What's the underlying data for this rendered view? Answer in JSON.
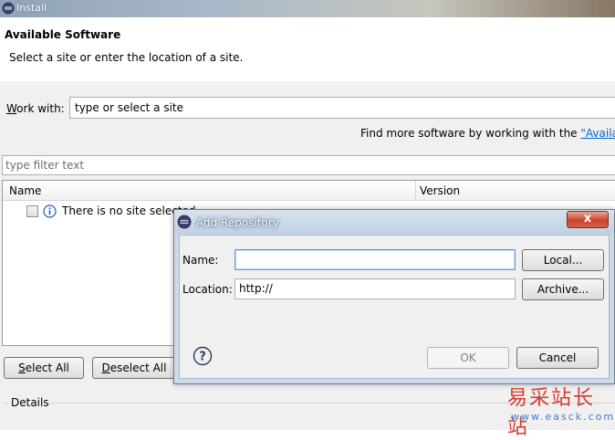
{
  "window": {
    "title": "Install"
  },
  "header": {
    "title": "Available Software",
    "description": "Select a site or enter the location of a site."
  },
  "work_with": {
    "label_prefix": "W",
    "label_rest": "ork with:",
    "value": "type or select a site"
  },
  "find_more": {
    "text": "Find more software by working with the ",
    "link": "\"Availab"
  },
  "filter": {
    "placeholder": "type filter text"
  },
  "tree": {
    "columns": [
      "Name",
      "Version"
    ],
    "rows": [
      {
        "text": "There is no site selected."
      }
    ]
  },
  "buttons": {
    "select_all": {
      "mnemonic": "S",
      "rest": "elect All"
    },
    "deselect_all": {
      "mnemonic": "D",
      "rest": "eselect All"
    }
  },
  "details": {
    "label": "Details"
  },
  "dialog": {
    "title": "Add Repository",
    "close_label": "x",
    "name_label": "Name:",
    "name_value": "",
    "location_label": "Location:",
    "location_value": "http://",
    "local_button": "Local...",
    "archive_button": "Archive...",
    "ok_button": "OK",
    "cancel_button": "Cancel"
  },
  "watermark": {
    "cn": "易采站长站",
    "url": "www.easck.com"
  },
  "colors": {
    "link": "#0066cc",
    "close": "#c7452a",
    "focus": "#5d9fd9"
  }
}
